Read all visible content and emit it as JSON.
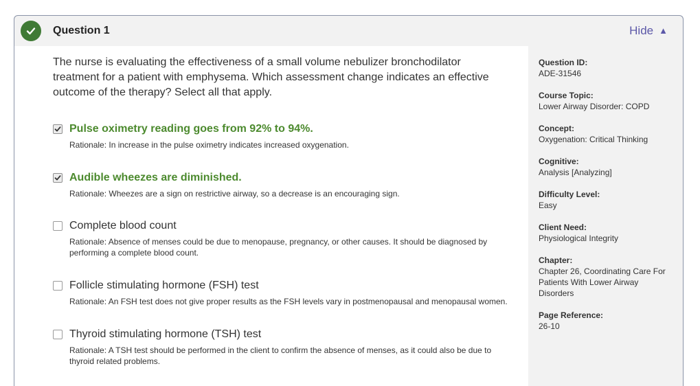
{
  "header": {
    "title": "Question 1",
    "hide_label": "Hide",
    "hide_icon": "triangle-up-icon",
    "status_icon": "check-circle-icon",
    "status_color": "#3f7a35"
  },
  "question": {
    "stem": "The nurse is evaluating the effectiveness of a small volume nebulizer bronchodilator treatment for a patient with emphysema. Which assessment change indicates an effective outcome of the therapy? Select all that apply.",
    "options": [
      {
        "label": "Pulse oximetry reading goes from 92% to 94%.",
        "checked": true,
        "correct": true,
        "rationale": "Rationale: In increase in the pulse oximetry indicates increased oxygenation."
      },
      {
        "label": "Audible wheezes are diminished.",
        "checked": true,
        "correct": true,
        "rationale": "Rationale: Wheezes are a sign on restrictive airway, so a decrease is an encouraging sign."
      },
      {
        "label": "Complete blood count",
        "checked": false,
        "correct": false,
        "rationale": "Rationale: Absence of menses could be due to menopause, pregnancy, or other causes. It should be diagnosed by performing a complete blood count."
      },
      {
        "label": "Follicle stimulating hormone (FSH) test",
        "checked": false,
        "correct": false,
        "rationale": "Rationale: An FSH test does not give proper results as the FSH levels vary in postmenopausal and menopausal women."
      },
      {
        "label": "Thyroid stimulating hormone (TSH) test",
        "checked": false,
        "correct": false,
        "rationale": "Rationale: A TSH test should be performed in the client to confirm the absence of menses, as it could also be due to thyroid related problems."
      }
    ],
    "correct_color": "#4c8a2e"
  },
  "sidebar": {
    "items": [
      {
        "key": "Question ID:",
        "value": "ADE-31546"
      },
      {
        "key": "Course Topic:",
        "value": "Lower Airway Disorder: COPD"
      },
      {
        "key": "Concept:",
        "value": "Oxygenation: Critical Thinking"
      },
      {
        "key": "Cognitive:",
        "value": "Analysis [Analyzing]"
      },
      {
        "key": "Difficulty Level:",
        "value": "Easy"
      },
      {
        "key": "Client Need:",
        "value": "Physiological Integrity"
      },
      {
        "key": "Chapter:",
        "value": "Chapter 26, Coordinating Care For Patients With Lower Airway Disorders"
      },
      {
        "key": "Page Reference:",
        "value": "26-10"
      }
    ]
  }
}
